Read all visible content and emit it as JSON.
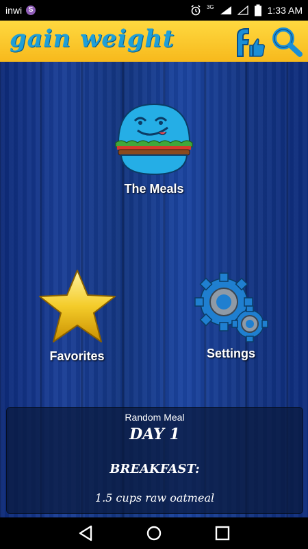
{
  "status_bar": {
    "carrier": "inwi",
    "viber_badge": "S",
    "network": "3G",
    "time": "1:33 AM"
  },
  "app_bar": {
    "title": "gain weight",
    "facebook_icon": "facebook-like-icon",
    "search_icon": "search-icon"
  },
  "menu": {
    "meals_label": "The Meals",
    "favorites_label": "Favorites",
    "settings_label": "Settings"
  },
  "random_meal": {
    "heading": "Random Meal",
    "day": "DAY 1",
    "meal_type": "BREAKFAST:",
    "item": "1.5 cups raw oatmeal"
  },
  "colors": {
    "app_bar": "#f7c52a",
    "title": "#1f9fd8",
    "background": "#13357f"
  }
}
